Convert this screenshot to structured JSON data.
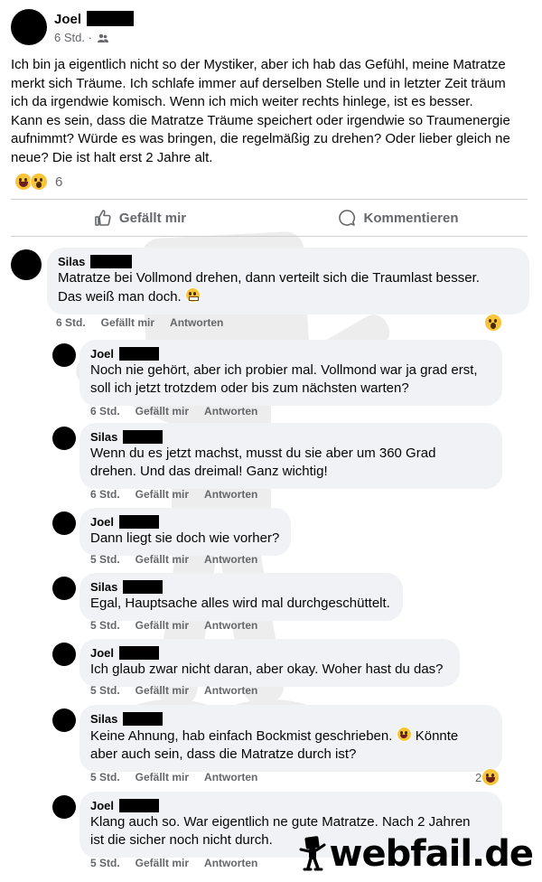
{
  "post": {
    "author": "Joel",
    "time": "6 Std.",
    "separator": "·",
    "text_lines": [
      "Ich bin ja eigentlich nicht so der Mystiker, aber ich hab das Gefühl, meine Matratze",
      "merkt sich Träume. Ich schlafe immer auf derselben Stelle und in letzter Zeit träum",
      "ich da irgendwie komisch. Wenn ich mich weiter rechts hinlege, ist es besser.",
      "Kann es sein, dass die Matratze Träume speichert oder irgendwie so Traumenergie",
      "aufnimmt? Würde es was bringen, die regelmäßig zu drehen? Oder lieber gleich ne",
      "neue? Die ist halt erst 2 Jahre alt."
    ],
    "reactions": {
      "icons": [
        "laughing-emoji",
        "wow-emoji"
      ],
      "count": "6"
    }
  },
  "actions": {
    "like": "Gefällt mir",
    "comment": "Kommentieren"
  },
  "comments": [
    {
      "name": "Silas",
      "lines": [
        "Matratze bei Vollmond drehen, dann verteilt sich die Traumlast besser.",
        "Das weiß man doch."
      ],
      "time": "6 Std.",
      "like": "Gefällt mir",
      "reply": "Antworten",
      "reaction_icon": "wow-emoji",
      "reaction_count": ""
    },
    {
      "name": "Joel",
      "lines": [
        "Noch nie gehört, aber ich probier mal. Vollmond war ja grad erst,",
        "soll ich jetzt trotzdem oder bis zum nächsten warten?"
      ],
      "time": "6 Std.",
      "like": "Gefällt mir",
      "reply": "Antworten"
    },
    {
      "name": "Silas",
      "lines": [
        "Wenn du es jetzt machst, musst du sie aber um 360 Grad",
        "drehen. Und das dreimal! Ganz wichtig!"
      ],
      "time": "6 Std.",
      "like": "Gefällt mir",
      "reply": "Antworten"
    },
    {
      "name": "Joel",
      "lines": [
        "Dann liegt sie doch wie vorher?"
      ],
      "time": "5 Std.",
      "like": "Gefällt mir",
      "reply": "Antworten"
    },
    {
      "name": "Silas",
      "lines": [
        "Egal, Hauptsache alles wird mal durchgeschüttelt."
      ],
      "time": "5 Std.",
      "like": "Gefällt mir",
      "reply": "Antworten"
    },
    {
      "name": "Joel",
      "lines": [
        "Ich glaub zwar nicht daran, aber okay. Woher hast du das?"
      ],
      "time": "5 Std.",
      "like": "Gefällt mir",
      "reply": "Antworten"
    },
    {
      "name": "Silas",
      "lines": [
        "Keine Ahnung, hab einfach Bockmist geschrieben.",
        "aber auch sein, dass die Matratze durch ist?"
      ],
      "line1_suffix": "Könnte",
      "time": "5 Std.",
      "like": "Gefällt mir",
      "reply": "Antworten",
      "reaction_icon": "laughing-emoji",
      "reaction_count": "2"
    },
    {
      "name": "Joel",
      "lines": [
        "Klang auch so. War eigentlich ne gute Matratze. Nach 2 Jahren",
        "ist die sicher noch nicht durch."
      ],
      "time": "5 Std.",
      "like": "Gefällt mir",
      "reply": "Antworten"
    }
  ],
  "watermark": {
    "logo_text": "webfail.de"
  }
}
